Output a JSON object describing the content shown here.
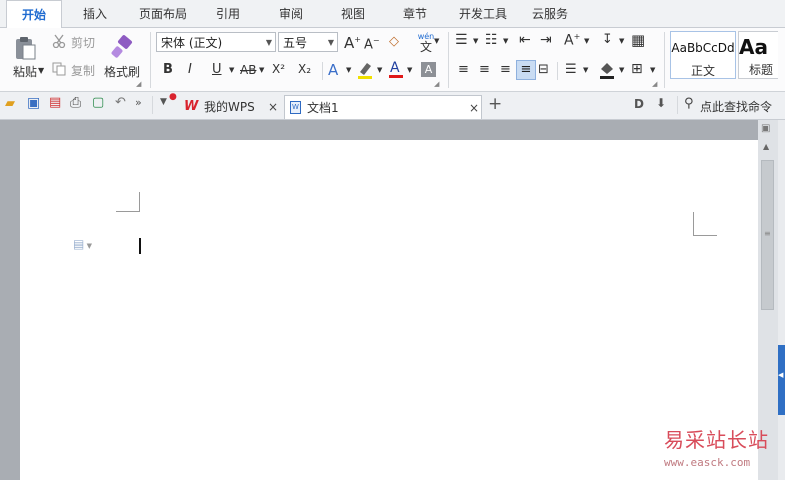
{
  "menu": {
    "tabs": [
      {
        "label": "开始"
      },
      {
        "label": "插入"
      },
      {
        "label": "页面布局"
      },
      {
        "label": "引用"
      },
      {
        "label": "审阅"
      },
      {
        "label": "视图"
      },
      {
        "label": "章节"
      },
      {
        "label": "开发工具"
      },
      {
        "label": "云服务"
      }
    ]
  },
  "ribbon": {
    "clipboard": {
      "paste": "粘贴",
      "cut": "剪切",
      "copy": "复制",
      "format_painter": "格式刷"
    },
    "font": {
      "name": "宋体 (正文)",
      "size": "五号"
    },
    "font_buttons": {
      "bold": "B",
      "italic": "I",
      "underline": "U",
      "strike": "AB",
      "superscript": "X²",
      "subscript": "X₂"
    },
    "pinyin": "wén",
    "styles": [
      {
        "preview": "AaBbCcDd",
        "name": "正文"
      },
      {
        "preview": "Aa",
        "name": "标题"
      }
    ]
  },
  "quickbar": {
    "tabs": [
      {
        "label": "我的WPS"
      },
      {
        "label": "文档1"
      }
    ],
    "search_label": "点此查找命令"
  },
  "watermark": {
    "text": "易采站长站",
    "url": "www.easck.com"
  },
  "colors": {
    "accent": "#1f6bd0",
    "wps_red": "#d9232e",
    "scroll_blue": "#2f6fc4"
  }
}
